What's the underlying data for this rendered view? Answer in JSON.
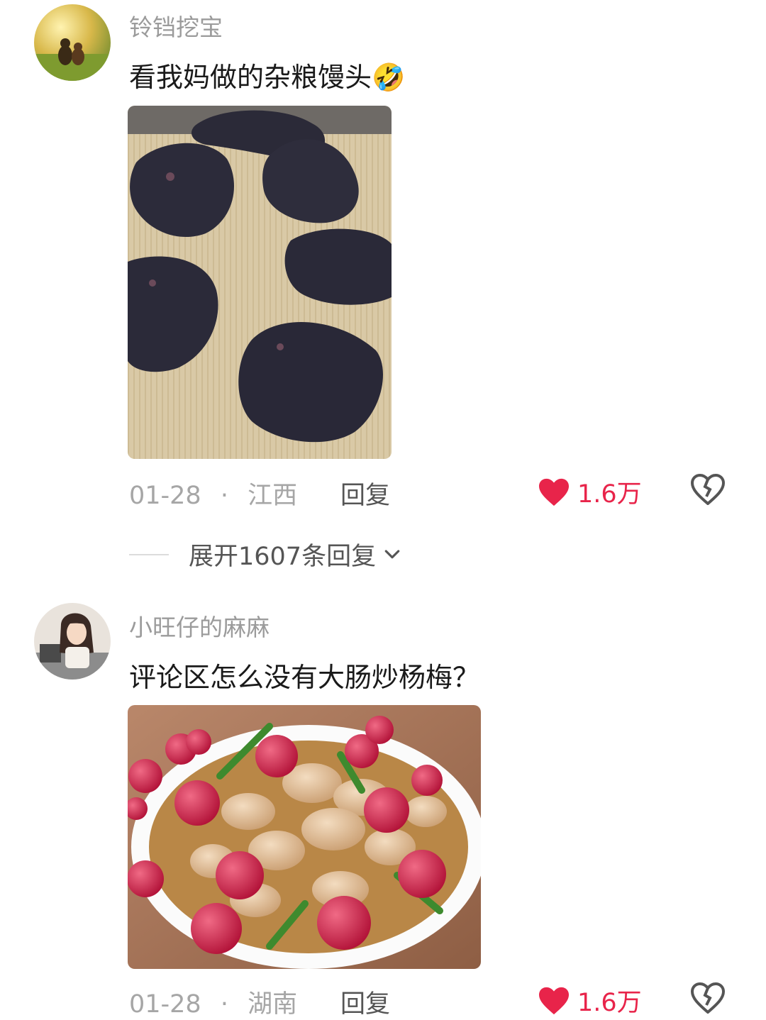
{
  "comments": [
    {
      "username": "铃铛挖宝",
      "text": "看我妈做的杂粮馒头",
      "emoji": "🤣",
      "date": "01-28",
      "separator": "·",
      "location": "江西",
      "reply_label": "回复",
      "likes": "1.6万",
      "expand_label": "展开1607条回复",
      "photo_icon": "steamed-bun-photo"
    },
    {
      "username": "小旺仔的麻麻",
      "text": "评论区怎么没有大肠炒杨梅？",
      "date": "01-28",
      "separator": "·",
      "location": "湖南",
      "reply_label": "回复",
      "likes": "1.6万",
      "photo_icon": "intestine-bayberry-photo"
    }
  ],
  "colors": {
    "like": "#e8244a",
    "meta": "#a6a6a6",
    "username": "#9b9b9b"
  }
}
